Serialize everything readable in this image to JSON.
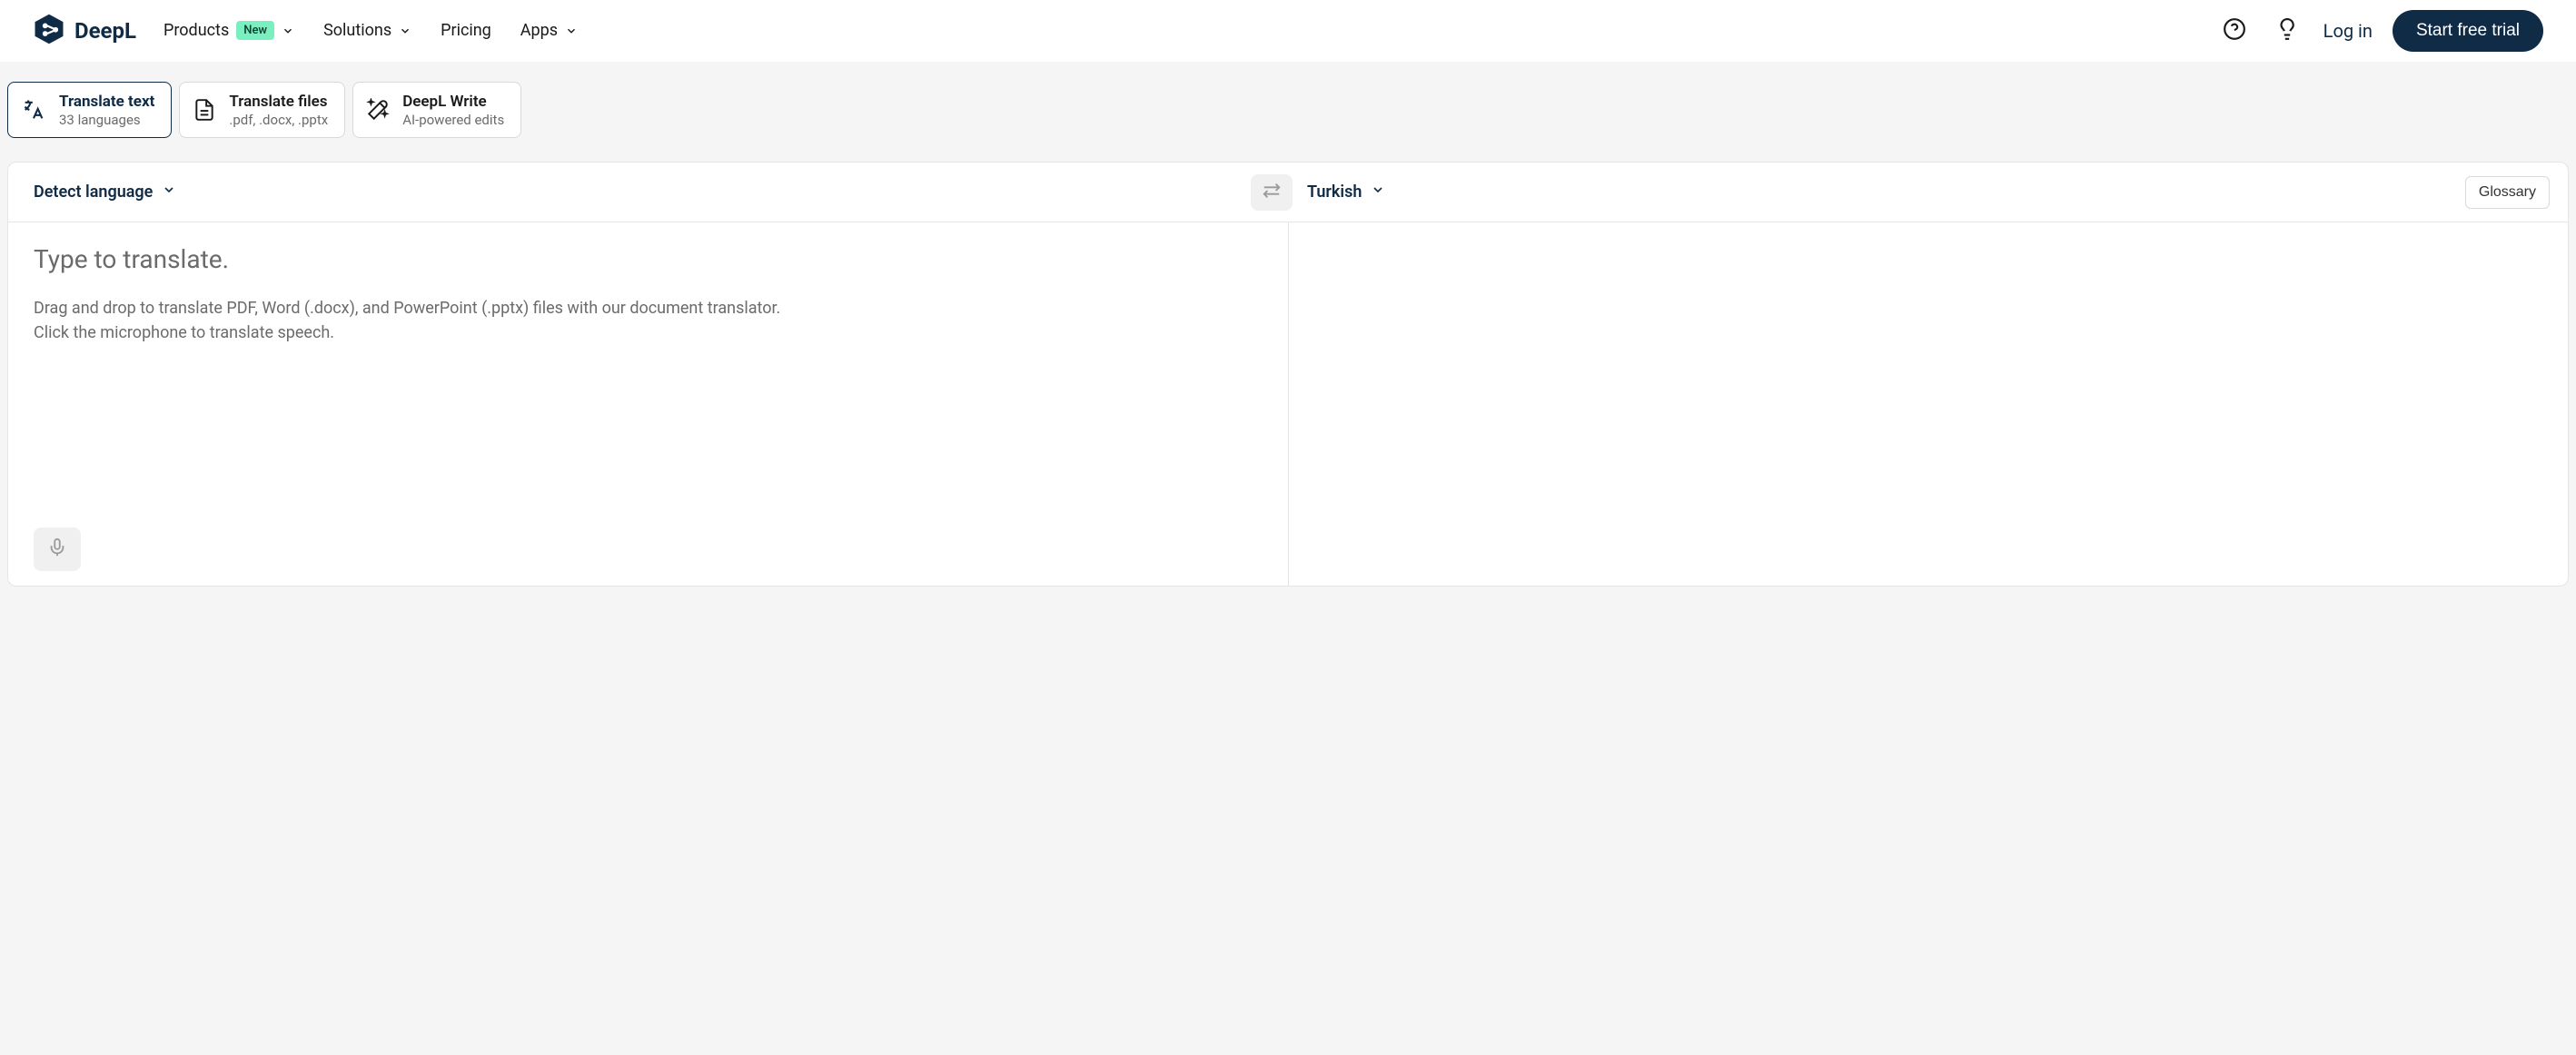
{
  "header": {
    "logo_text": "DeepL",
    "nav": {
      "products": "Products",
      "products_badge": "New",
      "solutions": "Solutions",
      "pricing": "Pricing",
      "apps": "Apps"
    },
    "login": "Log in",
    "cta": "Start free trial"
  },
  "tabs": {
    "translate_text": {
      "title": "Translate text",
      "subtitle": "33 languages"
    },
    "translate_files": {
      "title": "Translate files",
      "subtitle": ".pdf, .docx, .pptx"
    },
    "write": {
      "title": "DeepL Write",
      "subtitle": "AI-powered edits"
    }
  },
  "translator": {
    "source_language": "Detect language",
    "target_language": "Turkish",
    "glossary_label": "Glossary",
    "placeholder": "Type to translate.",
    "hint_line1": "Drag and drop to translate PDF, Word (.docx), and PowerPoint (.pptx) files with our document translator.",
    "hint_line2": "Click the microphone to translate speech."
  }
}
